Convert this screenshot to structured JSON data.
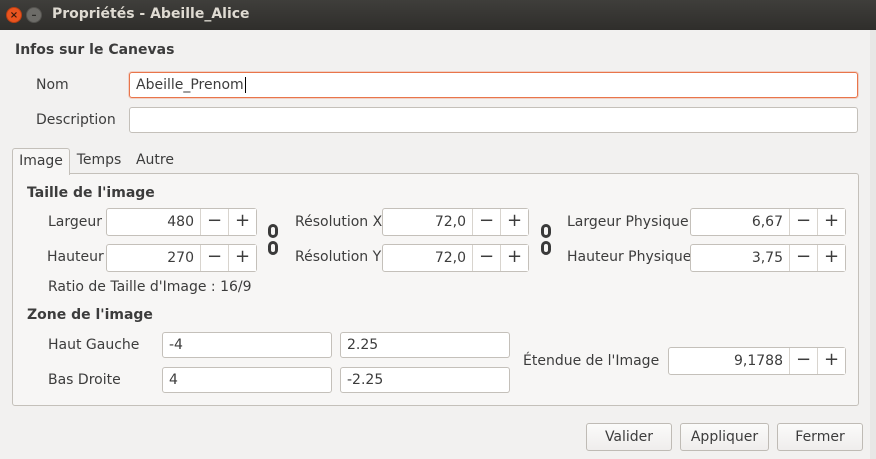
{
  "window": {
    "title": "Propriétés - Abeille_Alice",
    "close_glyph": "×",
    "minimize_glyph": "–"
  },
  "canvas_info": {
    "heading": "Infos sur le Canevas",
    "name_label": "Nom",
    "name_value": "Abeille_Prenom",
    "description_label": "Description",
    "description_value": ""
  },
  "tabs": [
    {
      "label": "Image",
      "active": true
    },
    {
      "label": "Temps",
      "active": false
    },
    {
      "label": "Autre",
      "active": false
    }
  ],
  "image_size": {
    "heading": "Taille de l'image",
    "width_label": "Largeur",
    "width_value": "480",
    "height_label": "Hauteur",
    "height_value": "270",
    "res_x_label": "Résolution X",
    "res_x_value": "72,0",
    "res_y_label": "Résolution Y",
    "res_y_value": "72,0",
    "phys_width_label": "Largeur Physique",
    "phys_width_value": "6,67",
    "phys_height_label": "Hauteur Physique",
    "phys_height_value": "3,75",
    "ratio_text": "Ratio de Taille d'Image : 16/9",
    "minus": "−",
    "plus": "+"
  },
  "image_area": {
    "heading": "Zone de l'image",
    "top_left_label": "Haut Gauche",
    "top_left_x": "-4",
    "top_left_y": "2.25",
    "bottom_right_label": "Bas Droite",
    "bottom_right_x": "4",
    "bottom_right_y": "-2.25",
    "span_label": "Étendue de l'Image",
    "span_value": "9,1788"
  },
  "buttons": {
    "ok": "Valider",
    "apply": "Appliquer",
    "close": "Fermer"
  },
  "colors": {
    "titlebar": "#3c3b37",
    "accent_focus": "#e9754a",
    "close_button": "#e9541f"
  }
}
